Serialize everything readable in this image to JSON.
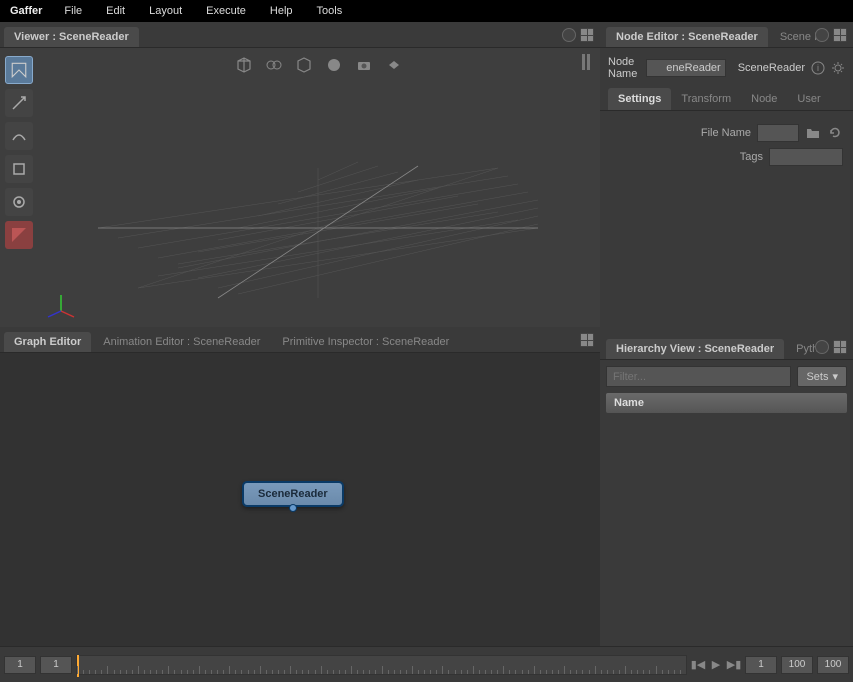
{
  "menubar": {
    "app": "Gaffer",
    "items": [
      "File",
      "Edit",
      "Layout",
      "Execute",
      "Help",
      "Tools"
    ]
  },
  "viewer": {
    "tab": "Viewer : SceneReader"
  },
  "graph": {
    "tabs": [
      "Graph Editor",
      "Animation Editor : SceneReader",
      "Primitive Inspector : SceneReader"
    ],
    "node_label": "SceneReader"
  },
  "node_editor": {
    "tab": "Node Editor : SceneReader",
    "tab2": "Scene In",
    "name_label": "Node Name",
    "name_value": "eneReader",
    "title": "SceneReader",
    "subtabs": [
      "Settings",
      "Transform",
      "Node",
      "User"
    ],
    "file_label": "File Name",
    "file_value": "",
    "tags_label": "Tags",
    "tags_value": ""
  },
  "hierarchy": {
    "tab": "Hierarchy View : SceneReader",
    "tab2": "Pytho",
    "filter_placeholder": "Filter...",
    "sets_label": "Sets",
    "column": "Name"
  },
  "timeline": {
    "start1": "1",
    "start2": "1",
    "cur": "1",
    "end1": "100",
    "end2": "100"
  }
}
